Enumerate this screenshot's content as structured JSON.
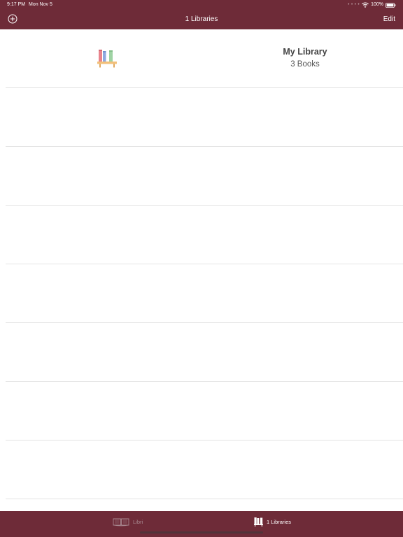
{
  "status_bar": {
    "time": "9:17 PM",
    "date": "Mon Nov 5",
    "battery": "100%",
    "icons": [
      "wifi-icon",
      "battery-icon"
    ]
  },
  "nav": {
    "add_icon": "plus-circle-icon",
    "title": "1 Libraries",
    "edit_label": "Edit"
  },
  "libraries": [
    {
      "icon": "bookshelf-icon",
      "name": "My Library",
      "count": "3 Books"
    }
  ],
  "tabs": [
    {
      "label": "Libri",
      "icon": "open-book-icon",
      "selected": false
    },
    {
      "label": "1 Libraries",
      "icon": "bookshelf-icon",
      "selected": true
    }
  ],
  "colors": {
    "bar_background": "#6e2b38",
    "tab_inactive": "#a88890",
    "tab_active": "#ffffff",
    "separator": "#e4e4e4"
  }
}
